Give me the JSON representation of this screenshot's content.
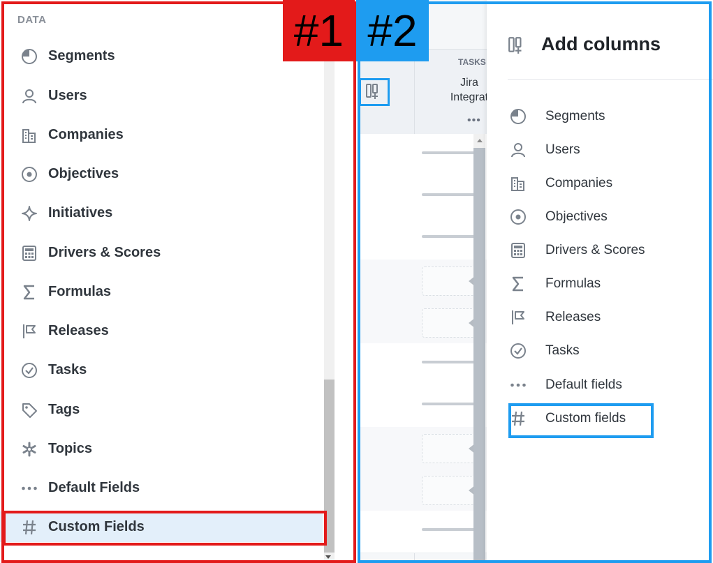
{
  "panel1": {
    "tag": "#1",
    "section_label": "DATA",
    "items": [
      {
        "label": "Segments",
        "icon": "segments-icon"
      },
      {
        "label": "Users",
        "icon": "user-icon"
      },
      {
        "label": "Companies",
        "icon": "building-icon"
      },
      {
        "label": "Objectives",
        "icon": "target-icon"
      },
      {
        "label": "Initiatives",
        "icon": "sparkle-icon"
      },
      {
        "label": "Drivers & Scores",
        "icon": "calculator-icon"
      },
      {
        "label": "Formulas",
        "icon": "sigma-icon"
      },
      {
        "label": "Releases",
        "icon": "flag-icon"
      },
      {
        "label": "Tasks",
        "icon": "check-circle-icon"
      },
      {
        "label": "Tags",
        "icon": "tag-icon"
      },
      {
        "label": "Topics",
        "icon": "asterisk-icon"
      },
      {
        "label": "Default Fields",
        "icon": "dots-icon"
      },
      {
        "label": "Custom Fields",
        "icon": "hash-icon",
        "selected": true
      }
    ]
  },
  "panel2": {
    "tag": "#2",
    "column_header": {
      "group": "TASKS",
      "title_line1": "Jira",
      "title_line2": "Integrat",
      "menu": "•••"
    },
    "drawer": {
      "title": "Add columns",
      "items": [
        {
          "label": "Segments",
          "icon": "segments-icon"
        },
        {
          "label": "Users",
          "icon": "user-icon"
        },
        {
          "label": "Companies",
          "icon": "building-icon"
        },
        {
          "label": "Objectives",
          "icon": "target-icon"
        },
        {
          "label": "Drivers & Scores",
          "icon": "calculator-icon"
        },
        {
          "label": "Formulas",
          "icon": "sigma-icon"
        },
        {
          "label": "Releases",
          "icon": "flag-icon"
        },
        {
          "label": "Tasks",
          "icon": "check-circle-icon"
        },
        {
          "label": "Default fields",
          "icon": "dots-icon"
        },
        {
          "label": "Custom fields",
          "icon": "hash-icon",
          "highlighted": true
        }
      ]
    }
  },
  "colors": {
    "annotation_red": "#e31a1a",
    "annotation_blue": "#1e9cf0",
    "selected_bg": "#e3effa",
    "icon_gray": "#7a828c"
  }
}
